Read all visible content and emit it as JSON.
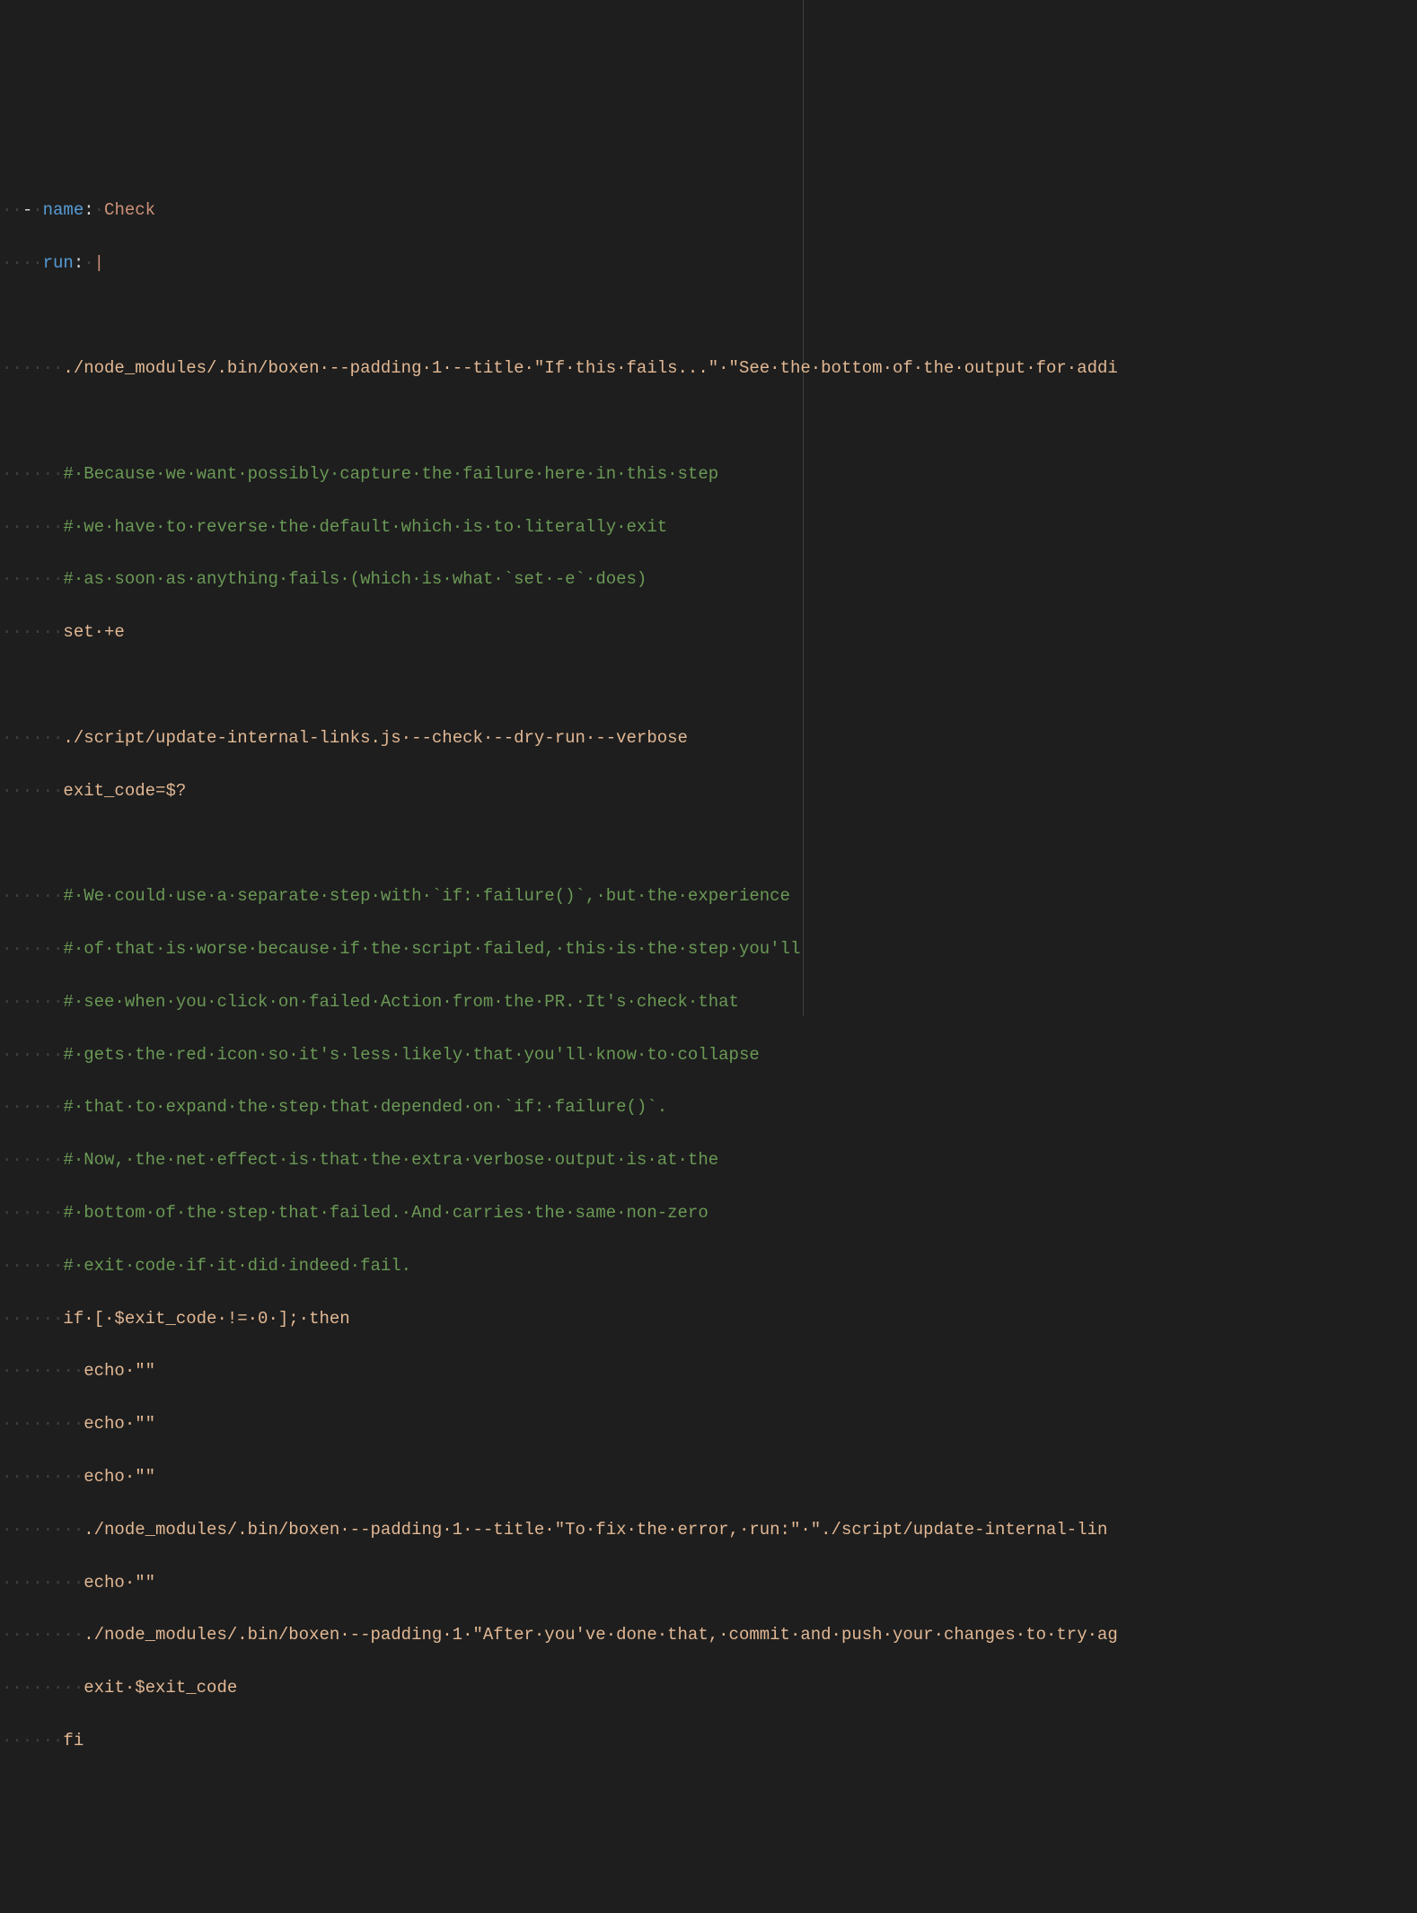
{
  "ws": {
    "dot": "·",
    "dash": "-",
    "i2": "··",
    "i6": "······",
    "i8": "········",
    "i10": "··········"
  },
  "keys": {
    "name": "name",
    "run": "run"
  },
  "punct": {
    "colon": ":",
    "pipe": "|"
  },
  "values": {
    "check": "Check"
  },
  "lines": {
    "l1_shell": "./node_modules/.bin/boxen·--padding·1·--title·\"If·this·fails...\"·\"See·the·bottom·of·the·output·for·addi",
    "l2_comment": "#·Because·we·want·possibly·capture·the·failure·here·in·this·step",
    "l3_comment": "#·we·have·to·reverse·the·default·which·is·to·literally·exit",
    "l4_comment": "#·as·soon·as·anything·fails·(which·is·what·`set·-e`·does)",
    "l5_shell": "set·+e",
    "l6_shell": "./script/update-internal-links.js·--check·--dry-run·--verbose",
    "l7_shell": "exit_code=$?",
    "l8_comment": "#·We·could·use·a·separate·step·with·`if:·failure()`,·but·the·experience",
    "l9_comment": "#·of·that·is·worse·because·if·the·script·failed,·this·is·the·step·you'll",
    "l10_comment": "#·see·when·you·click·on·failed·Action·from·the·PR.·It's·check·that",
    "l11_comment": "#·gets·the·red·icon·so·it's·less·likely·that·you'll·know·to·collapse",
    "l12_comment": "#·that·to·expand·the·step·that·depended·on·`if:·failure()`.",
    "l13_comment": "#·Now,·the·net·effect·is·that·the·extra·verbose·output·is·at·the",
    "l14_comment": "#·bottom·of·the·step·that·failed.·And·carries·the·same·non-zero",
    "l15_comment": "#·exit·code·if·it·did·indeed·fail.",
    "l16_shell": "if·[·$exit_code·!=·0·];·then",
    "l17_shell": "echo·\"\"",
    "l18_shell": "echo·\"\"",
    "l19_shell": "echo·\"\"",
    "l20_shell": "./node_modules/.bin/boxen·--padding·1·--title·\"To·fix·the·error,·run:\"·\"./script/update-internal-lin",
    "l21_shell": "echo·\"\"",
    "l22_shell": "./node_modules/.bin/boxen·--padding·1·\"After·you've·done·that,·commit·and·push·your·changes·to·try·ag",
    "l23_shell": "exit·$exit_code",
    "l24_shell": "fi"
  }
}
